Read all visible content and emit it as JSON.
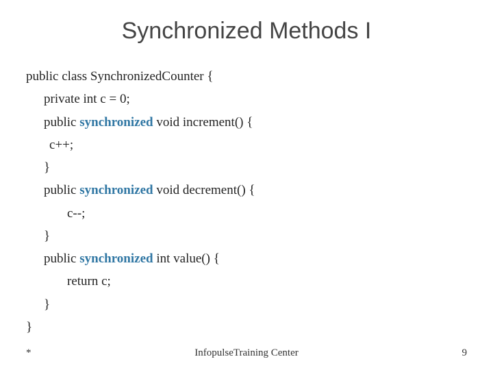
{
  "title": "Synchronized Methods I",
  "code": {
    "line1": "public class SynchronizedCounter {",
    "line2": "private int c = 0;",
    "line3a": "public ",
    "kw": "synchronized",
    "line3b": " void increment() {",
    "line4": "c++;",
    "line5": "}",
    "line6a": "public ",
    "line6b": " void decrement() {",
    "line7": "c--;",
    "line8": "}",
    "line9a": "public ",
    "line9b": " int value() {",
    "line10": "return c;",
    "line11": "}",
    "line12": "}"
  },
  "footer": {
    "left": "*",
    "center": "InfopulseTraining Center",
    "right": "9"
  }
}
